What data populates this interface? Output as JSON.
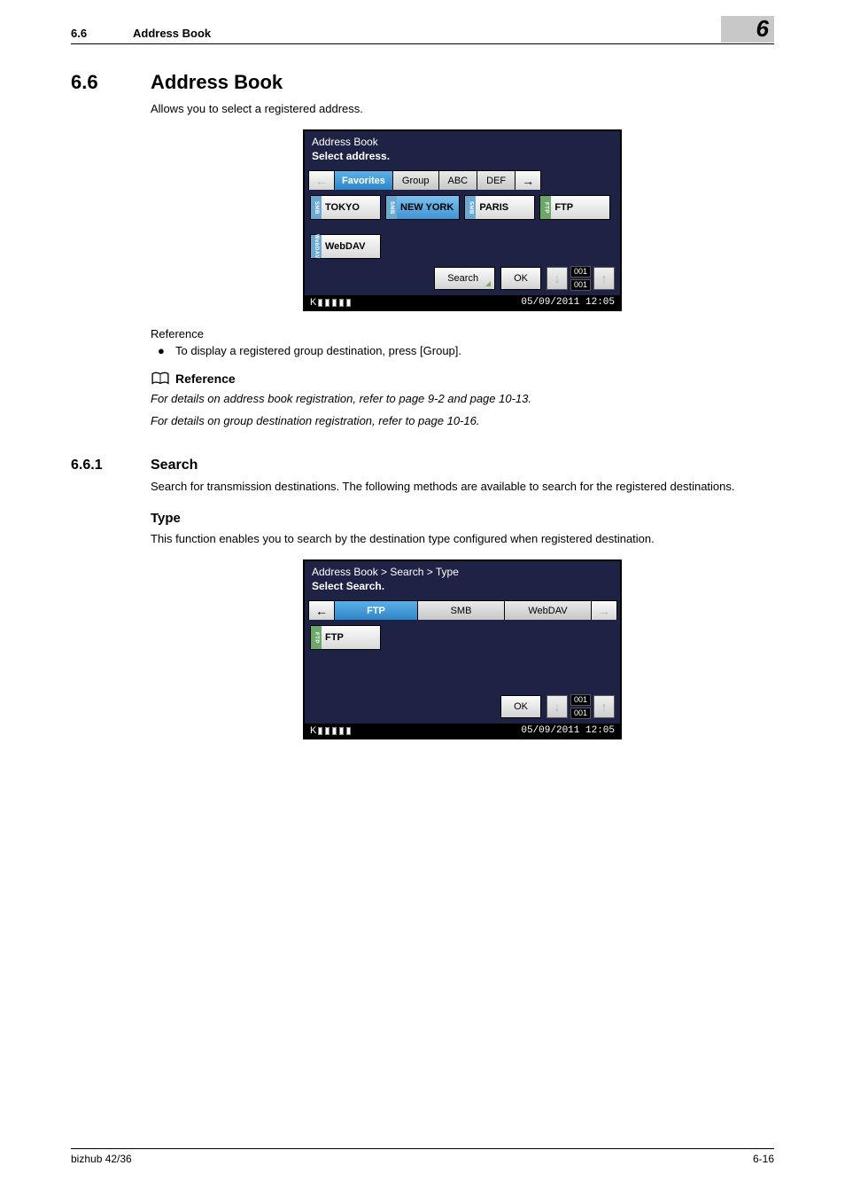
{
  "header": {
    "section_number": "6.6",
    "section_title": "Address Book",
    "chapter_tab": "6"
  },
  "section": {
    "number": "6.6",
    "title": "Address Book",
    "intro": "Allows you to select a registered address."
  },
  "panel1": {
    "title_line1": "Address Book",
    "title_line2": "Select address.",
    "arrow_left": "←",
    "tabs": {
      "favorites": "Favorites",
      "group": "Group",
      "abc": "ABC",
      "def": "DEF"
    },
    "arrow_right": "→",
    "chips": {
      "tokyo": "TOKYO",
      "newyork": "NEW YORK",
      "paris": "PARIS",
      "ftp": "FTP",
      "webdav": "WebDAV"
    },
    "buttons": {
      "search": "Search",
      "ok": "OK"
    },
    "pager": {
      "current": "001",
      "total": "001"
    },
    "status_left_k": "K",
    "status_right": "05/09/2011 12:05"
  },
  "reference": {
    "label": "Reference",
    "bullet": "To display a registered group destination, press [Group].",
    "box_label": "Reference",
    "ref1": "For details on address book registration, refer to page 9-2 and page 10-13.",
    "ref2": "For details on group destination registration, refer to page 10-16."
  },
  "subsection": {
    "number": "6.6.1",
    "title": "Search",
    "intro": "Search for transmission destinations. The following methods are available to search for the registered destinations."
  },
  "type": {
    "heading": "Type",
    "intro": "This function enables you to search by the destination type configured when registered destination."
  },
  "panel2": {
    "title_line1": "Address Book > Search > Type",
    "title_line2": "Select Search.",
    "arrow_left": "←",
    "tabs": {
      "ftp": "FTP",
      "smb": "SMB",
      "webdav": "WebDAV"
    },
    "arrow_right": "→",
    "chips": {
      "ftp": "FTP"
    },
    "buttons": {
      "ok": "OK"
    },
    "pager": {
      "current": "001",
      "total": "001"
    },
    "status_left_k": "K",
    "status_right": "05/09/2011 12:05"
  },
  "footer": {
    "left": "bizhub 42/36",
    "right": "6-16"
  },
  "icons": {
    "arrow_down": "↓",
    "arrow_up": "↑"
  }
}
